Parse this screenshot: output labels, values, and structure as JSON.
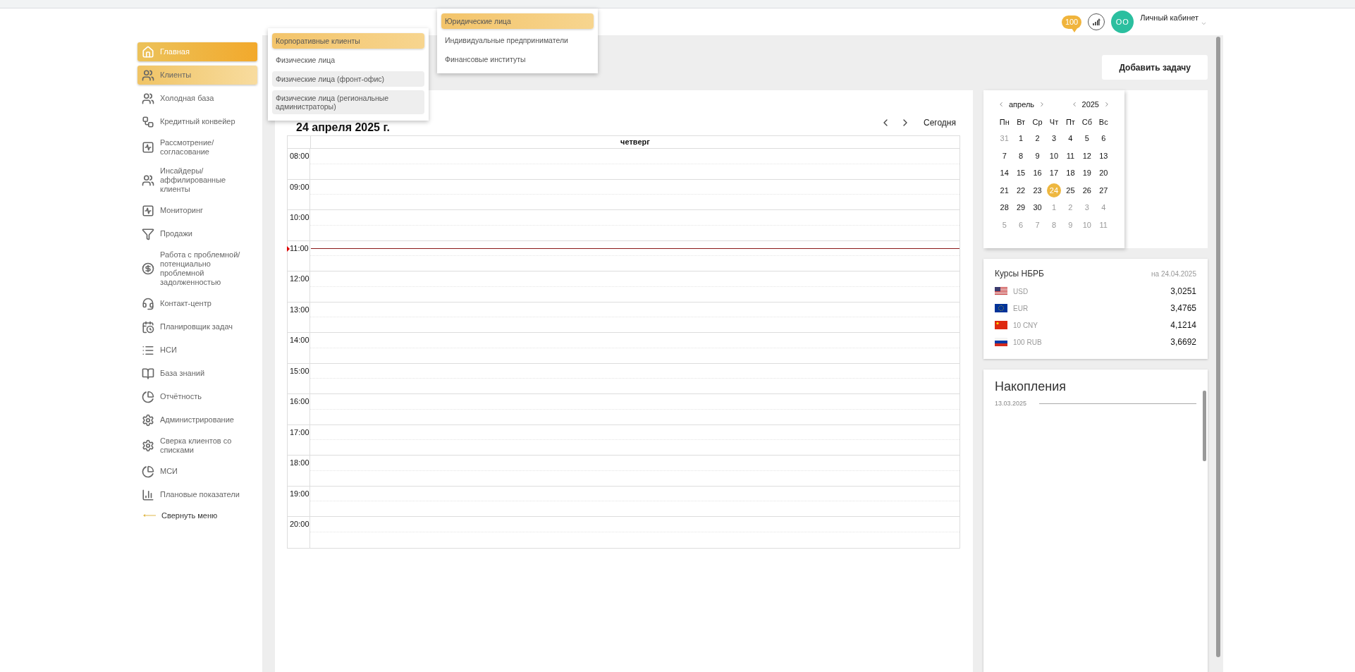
{
  "header": {
    "badge": "100",
    "avatar": "ОО",
    "account": "Личный кабинет"
  },
  "sidebar": {
    "items": [
      {
        "label": "Главная",
        "selected": true,
        "expanded": false
      },
      {
        "label": "Клиенты",
        "selected": false,
        "expanded": true
      },
      {
        "label": "Холодная база",
        "selected": false,
        "expanded": false
      },
      {
        "label": "Кредитный конвейер",
        "selected": false,
        "expanded": false
      },
      {
        "label": "Рассмотрение/ согласование",
        "selected": false,
        "expanded": false
      },
      {
        "label": "Инсайдеры/ аффилированные клиенты",
        "selected": false,
        "expanded": false
      },
      {
        "label": "Мониторинг",
        "selected": false,
        "expanded": false
      },
      {
        "label": "Продажи",
        "selected": false,
        "expanded": false
      },
      {
        "label": "Работа с проблемной/ потенциально проблемной задолженностью",
        "selected": false,
        "expanded": false
      },
      {
        "label": "Контакт-центр",
        "selected": false,
        "expanded": false
      },
      {
        "label": "Планировщик задач",
        "selected": false,
        "expanded": false
      },
      {
        "label": "НСИ",
        "selected": false,
        "expanded": false
      },
      {
        "label": "База знаний",
        "selected": false,
        "expanded": false
      },
      {
        "label": "Отчётность",
        "selected": false,
        "expanded": false
      },
      {
        "label": "Администрирование",
        "selected": false,
        "expanded": false
      },
      {
        "label": "Сверка клиентов со списками",
        "selected": false,
        "expanded": false
      },
      {
        "label": "МСИ",
        "selected": false,
        "expanded": false
      },
      {
        "label": "Плановые показатели",
        "selected": false,
        "expanded": false
      }
    ],
    "collapse": "Свернуть меню"
  },
  "clients_menu": [
    {
      "label": "Корпоративные клиенты",
      "selected": true,
      "shaded": false
    },
    {
      "label": "Физические лица",
      "selected": false,
      "shaded": false
    },
    {
      "label": "Физические лица (фронт-офис)",
      "selected": false,
      "shaded": true
    },
    {
      "label": "Физические лица (региональные администраторы)",
      "selected": false,
      "shaded": true
    }
  ],
  "corporate_menu": [
    {
      "label": "Юридические лица",
      "selected": true
    },
    {
      "label": "Индивидуальные предприниматели",
      "selected": false
    },
    {
      "label": "Финансовые институты",
      "selected": false
    }
  ],
  "add_task_button": "Добавить задачу",
  "schedule": {
    "date_title": "24 апреля 2025 г.",
    "today_button": "Сегодня",
    "day_heading": "четверг",
    "hours": [
      {
        "time": "08:00",
        "current": false
      },
      {
        "time": "09:00",
        "current": false
      },
      {
        "time": "10:00",
        "current": false
      },
      {
        "time": "11:00",
        "current": true
      },
      {
        "time": "12:00",
        "current": false
      },
      {
        "time": "13:00",
        "current": false
      },
      {
        "time": "14:00",
        "current": false
      },
      {
        "time": "15:00",
        "current": false
      },
      {
        "time": "16:00",
        "current": false
      },
      {
        "time": "17:00",
        "current": false
      },
      {
        "time": "18:00",
        "current": false
      },
      {
        "time": "19:00",
        "current": false
      },
      {
        "time": "20:00",
        "current": false
      }
    ]
  },
  "mini_calendar": {
    "month": "апрель",
    "year": "2025",
    "weekdays": [
      "Пн",
      "Вт",
      "Ср",
      "Чт",
      "Пт",
      "Сб",
      "Вс"
    ],
    "weeks": [
      [
        {
          "day": "31",
          "muted": true,
          "selected": false
        },
        {
          "day": "1",
          "muted": false,
          "selected": false
        },
        {
          "day": "2",
          "muted": false,
          "selected": false
        },
        {
          "day": "3",
          "muted": false,
          "selected": false
        },
        {
          "day": "4",
          "muted": false,
          "selected": false
        },
        {
          "day": "5",
          "muted": false,
          "selected": false
        },
        {
          "day": "6",
          "muted": false,
          "selected": false
        }
      ],
      [
        {
          "day": "7",
          "muted": false,
          "selected": false
        },
        {
          "day": "8",
          "muted": false,
          "selected": false
        },
        {
          "day": "9",
          "muted": false,
          "selected": false
        },
        {
          "day": "10",
          "muted": false,
          "selected": false
        },
        {
          "day": "11",
          "muted": false,
          "selected": false
        },
        {
          "day": "12",
          "muted": false,
          "selected": false
        },
        {
          "day": "13",
          "muted": false,
          "selected": false
        }
      ],
      [
        {
          "day": "14",
          "muted": false,
          "selected": false
        },
        {
          "day": "15",
          "muted": false,
          "selected": false
        },
        {
          "day": "16",
          "muted": false,
          "selected": false
        },
        {
          "day": "17",
          "muted": false,
          "selected": false
        },
        {
          "day": "18",
          "muted": false,
          "selected": false
        },
        {
          "day": "19",
          "muted": false,
          "selected": false
        },
        {
          "day": "20",
          "muted": false,
          "selected": false
        }
      ],
      [
        {
          "day": "21",
          "muted": false,
          "selected": false
        },
        {
          "day": "22",
          "muted": false,
          "selected": false
        },
        {
          "day": "23",
          "muted": false,
          "selected": false
        },
        {
          "day": "24",
          "muted": false,
          "selected": true
        },
        {
          "day": "25",
          "muted": false,
          "selected": false
        },
        {
          "day": "26",
          "muted": false,
          "selected": false
        },
        {
          "day": "27",
          "muted": false,
          "selected": false
        }
      ],
      [
        {
          "day": "28",
          "muted": false,
          "selected": false
        },
        {
          "day": "29",
          "muted": false,
          "selected": false
        },
        {
          "day": "30",
          "muted": false,
          "selected": false
        },
        {
          "day": "1",
          "muted": true,
          "selected": false
        },
        {
          "day": "2",
          "muted": true,
          "selected": false
        },
        {
          "day": "3",
          "muted": true,
          "selected": false
        },
        {
          "day": "4",
          "muted": true,
          "selected": false
        }
      ],
      [
        {
          "day": "5",
          "muted": true,
          "selected": false
        },
        {
          "day": "6",
          "muted": true,
          "selected": false
        },
        {
          "day": "7",
          "muted": true,
          "selected": false
        },
        {
          "day": "8",
          "muted": true,
          "selected": false
        },
        {
          "day": "9",
          "muted": true,
          "selected": false
        },
        {
          "day": "10",
          "muted": true,
          "selected": false
        },
        {
          "day": "11",
          "muted": true,
          "selected": false
        }
      ]
    ]
  },
  "rates": {
    "title": "Курсы НБРБ",
    "date": "на 24.04.2025",
    "rows": [
      {
        "currency": "USD",
        "value": "3,0251"
      },
      {
        "currency": "EUR",
        "value": "3,4765"
      },
      {
        "currency": "10 CNY",
        "value": "4,1214"
      },
      {
        "currency": "100 RUB",
        "value": "3,6692"
      }
    ]
  },
  "savings": {
    "title": "Накопления",
    "date": "13.03.2025"
  }
}
